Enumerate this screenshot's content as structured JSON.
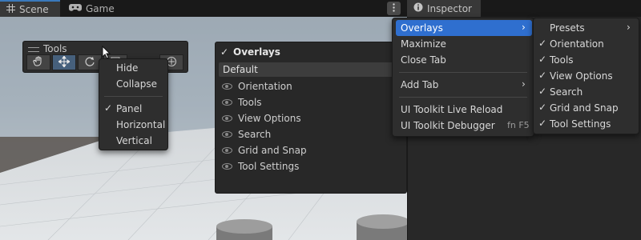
{
  "tabs": {
    "scene": "Scene",
    "game": "Game",
    "inspector": "Inspector"
  },
  "icons": {
    "scene": "grid-icon",
    "game": "gamepad-icon",
    "inspector": "info-icon",
    "more": "kebab-menu-icon",
    "tools": [
      "hand-icon",
      "move-icon",
      "rotate-icon",
      "rect-icon",
      "transform-icon"
    ],
    "eye": "eye-icon"
  },
  "tools_overlay": {
    "title": "Tools"
  },
  "tools_menu": {
    "items": [
      "Hide",
      "Collapse"
    ],
    "layout_items": [
      "Panel",
      "Horizontal",
      "Vertical"
    ],
    "checked": "Panel"
  },
  "overlays_panel": {
    "title": "Overlays",
    "preset": "Default",
    "items": [
      "Orientation",
      "Tools",
      "View Options",
      "Search",
      "Grid and Snap",
      "Tool Settings"
    ]
  },
  "tab_menu": {
    "overlays": "Overlays",
    "maximize": "Maximize",
    "close_tab": "Close Tab",
    "add_tab": "Add Tab",
    "live_reload": "UI Toolkit Live Reload",
    "debugger": "UI Toolkit Debugger",
    "debugger_shortcut": "fn F5"
  },
  "overlays_submenu": {
    "presets": "Presets",
    "items": [
      "Orientation",
      "Tools",
      "View Options",
      "Search",
      "Grid and Snap",
      "Tool Settings"
    ]
  },
  "colors": {
    "highlight": "#2f6fcf",
    "selected_tool": "#46607c",
    "menu_bg": "#2e2e2e"
  }
}
